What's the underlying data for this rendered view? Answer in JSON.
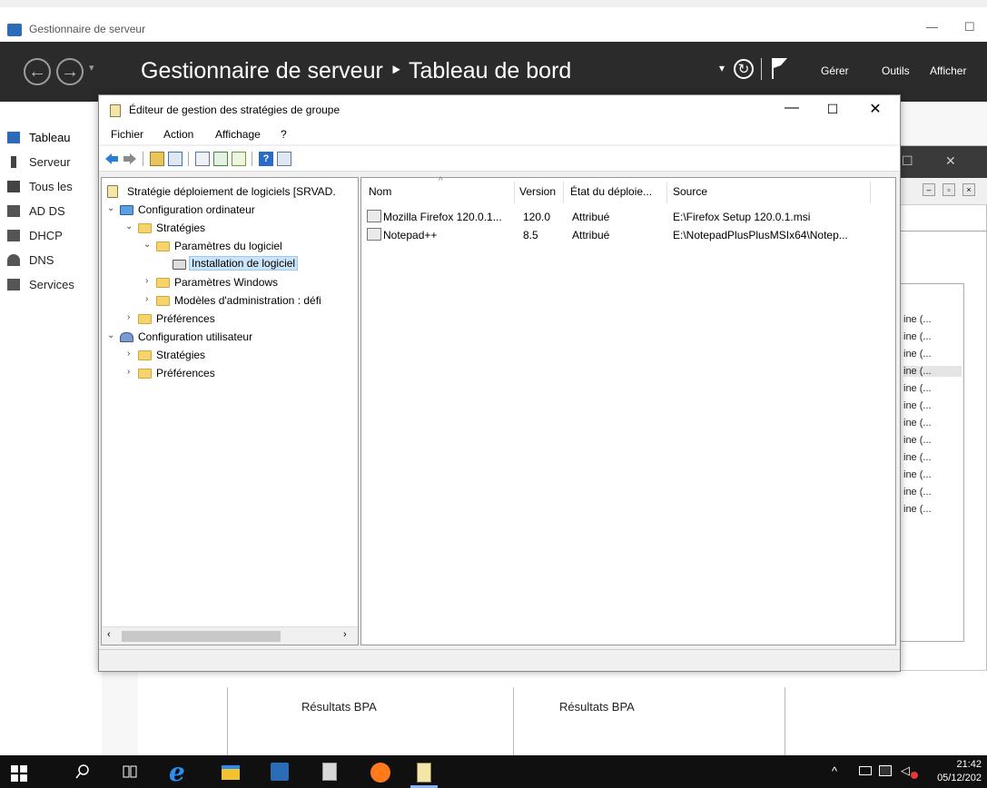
{
  "server_manager": {
    "window_title": "Gestionnaire de serveur",
    "header_title": "Gestionnaire de serveur ‣ Tableau de bord",
    "menus": [
      "Gérer",
      "Outils",
      "Afficher"
    ],
    "nav_items": [
      {
        "label": "Tableau",
        "icon": "dashboard-icon"
      },
      {
        "label": "Serveur",
        "icon": "server-icon"
      },
      {
        "label": "Tous les",
        "icon": "servers-icon"
      },
      {
        "label": "AD DS",
        "icon": "ad-ds-icon"
      },
      {
        "label": "DHCP",
        "icon": "dhcp-icon"
      },
      {
        "label": "DNS",
        "icon": "dns-icon"
      },
      {
        "label": "Services",
        "icon": "services-icon"
      }
    ],
    "bpa_labels": [
      "Résultats BPA",
      "Résultats BPA"
    ],
    "background_items": [
      "ine (...",
      "ine (...",
      "ine (...",
      "ine (...",
      "ine (...",
      "ine (...",
      "ine (...",
      "ine (...",
      "ine (...",
      "ine (...",
      "ine (...",
      "ine (..."
    ]
  },
  "gpo_editor": {
    "title": "Éditeur de gestion des stratégies de groupe",
    "menu": [
      "Fichier",
      "Action",
      "Affichage",
      "?"
    ],
    "tree": [
      {
        "label": "Stratégie déploiement de logiciels [SRVAD.",
        "type": "policy"
      },
      {
        "label": "Configuration ordinateur",
        "type": "computer"
      },
      {
        "label": "Stratégies",
        "type": "folder"
      },
      {
        "label": "Paramètres du logiciel",
        "type": "folder"
      },
      {
        "label": "Installation de logiciel",
        "type": "install",
        "selected": true
      },
      {
        "label": "Paramètres Windows",
        "type": "folder"
      },
      {
        "label": "Modèles d'administration : défi",
        "type": "folder"
      },
      {
        "label": "Préférences",
        "type": "folder"
      },
      {
        "label": "Configuration utilisateur",
        "type": "user"
      },
      {
        "label": "Stratégies",
        "type": "folder"
      },
      {
        "label": "Préférences",
        "type": "folder"
      }
    ],
    "columns": [
      "Nom",
      "Version",
      "État du déploie...",
      "Source"
    ],
    "rows": [
      {
        "name": "Mozilla Firefox 120.0.1...",
        "version": "120.0",
        "state": "Attribué",
        "source": "E:\\Firefox Setup 120.0.1.msi"
      },
      {
        "name": "Notepad++",
        "version": "8.5",
        "state": "Attribué",
        "source": "E:\\NotepadPlusPlusMSIx64\\Notep..."
      }
    ]
  },
  "taskbar": {
    "time": "21:42",
    "date": "05/12/202"
  }
}
